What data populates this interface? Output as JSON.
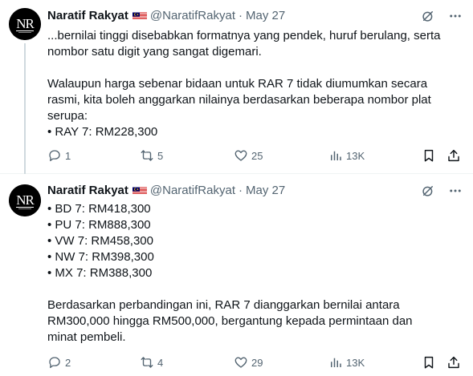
{
  "tweets": [
    {
      "author_name": "Naratif Rakyat",
      "handle": "@NaratifRakyat",
      "separator": "·",
      "date": "May 27",
      "lines_a": [
        "...bernilai tinggi disebabkan formatnya yang pendek, huruf berulang, serta",
        "nombor satu digit yang sangat digemari."
      ],
      "lines_b": [
        "Walaupun harga sebenar bidaan untuk RAR 7 tidak diumumkan secara",
        "rasmi, kita boleh anggarkan nilainya berdasarkan beberapa nombor plat",
        "serupa:",
        " • RAY 7: RM228,300"
      ],
      "replies": "1",
      "reposts": "5",
      "likes": "25",
      "views": "13K"
    },
    {
      "author_name": "Naratif Rakyat",
      "handle": "@NaratifRakyat",
      "separator": "·",
      "date": "May 27",
      "lines_a": [
        "• BD 7: RM418,300",
        " • PU 7: RM888,300",
        " • VW 7: RM458,300",
        " • NW 7: RM398,300",
        " • MX 7: RM388,300"
      ],
      "lines_b": [
        "Berdasarkan perbandingan ini, RAR 7 dianggarkan bernilai antara",
        "RM300,000 hingga RM500,000, bergantung kepada permintaan dan",
        "minat pembeli."
      ],
      "replies": "2",
      "reposts": "4",
      "likes": "29",
      "views": "13K"
    }
  ],
  "icons": {
    "avatar": "naratif-rakyat-logo",
    "flag": "malaysia-flag",
    "grok": "grok-icon",
    "more": "more-icon",
    "reply": "reply-icon",
    "repost": "repost-icon",
    "like": "like-icon",
    "views": "views-icon",
    "bookmark": "bookmark-icon",
    "share": "share-icon"
  },
  "colors": {
    "text": "#0f1419",
    "secondary": "#536471",
    "thread_line": "#cfd9de",
    "divider": "#eff3f4"
  }
}
